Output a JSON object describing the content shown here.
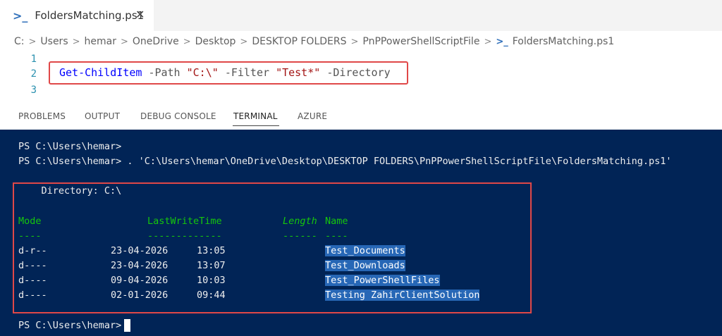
{
  "tab": {
    "title": "FoldersMatching.ps1",
    "icon": "powershell-icon",
    "close": "✕"
  },
  "breadcrumb": [
    "C:",
    "Users",
    "hemar",
    "OneDrive",
    "Desktop",
    "DESKTOP FOLDERS",
    "PnPPowerShellScriptFile",
    "FoldersMatching.ps1"
  ],
  "editor": {
    "line_numbers": [
      "1",
      "2",
      "3"
    ],
    "code": {
      "cmdlet": "Get-ChildItem",
      "path_param": "-Path",
      "path_value": "\"C:\\\"",
      "filter_param": "-Filter",
      "filter_value": "\"Test*\"",
      "directory_param": "-Directory"
    }
  },
  "panel_tabs": [
    "PROBLEMS",
    "OUTPUT",
    "DEBUG CONSOLE",
    "TERMINAL",
    "AZURE"
  ],
  "active_panel_tab": "TERMINAL",
  "terminal": {
    "prompt1": "PS C:\\Users\\hemar>",
    "prompt2": "PS C:\\Users\\hemar> . 'C:\\Users\\hemar\\OneDrive\\Desktop\\DESKTOP FOLDERS\\PnPPowerShellScriptFile\\FoldersMatching.ps1'",
    "directory_line": "    Directory: C:\\",
    "headers": {
      "mode": "Mode",
      "lastwrite": "LastWriteTime",
      "length": "Length",
      "name": "Name"
    },
    "underlines": {
      "mode": "----",
      "lastwrite": "-------------",
      "length": "------",
      "name": "----"
    },
    "rows": [
      {
        "mode": "d-r--",
        "date": "23-04-2026",
        "time": "13:05",
        "name": "Test_Documents"
      },
      {
        "mode": "d----",
        "date": "23-04-2026",
        "time": "13:07",
        "name": "Test_Downloads"
      },
      {
        "mode": "d----",
        "date": "09-04-2026",
        "time": "10:03",
        "name": "Test_PowerShellFiles"
      },
      {
        "mode": "d----",
        "date": "02-01-2026",
        "time": "09:44",
        "name": "Testing ZahirClientSolution"
      }
    ],
    "final_prompt": "PS C:\\Users\\hemar>"
  },
  "colors": {
    "terminal_bg": "#012456",
    "highlight": "#2767b6",
    "header_green": "#16c60c",
    "annotation_red": "#e04848"
  }
}
